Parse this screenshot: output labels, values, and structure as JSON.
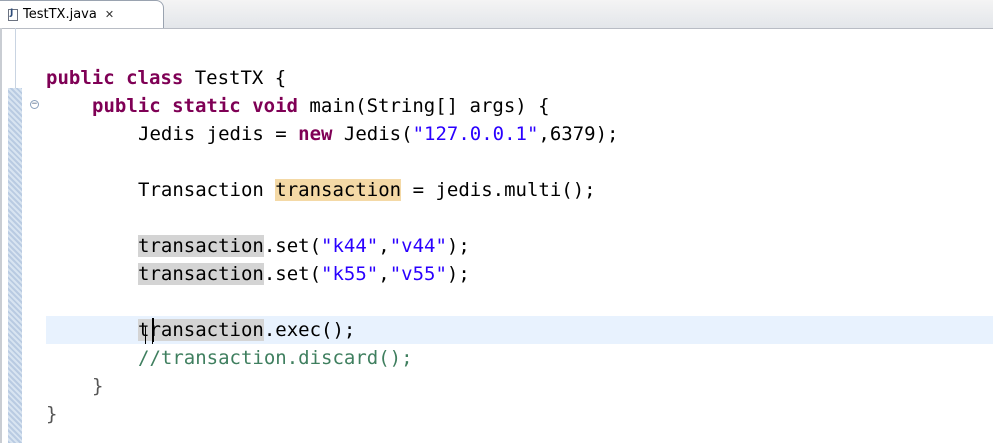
{
  "tab": {
    "title": "TestTX.java",
    "close_glyph": "✕"
  },
  "code": {
    "class_line": {
      "kw1": "public",
      "kw2": "class",
      "rest": " TestTX {"
    },
    "main_line": {
      "kw1": "public",
      "kw2": "static",
      "kw3": "void",
      "rest": " main(String[] args) {"
    },
    "jedis_line": {
      "pre": "Jedis jedis = ",
      "kw": "new",
      "mid": " Jedis(",
      "s1": "\"127.0.0.1\"",
      "post": ",6379);"
    },
    "tx_line": {
      "pre": "Transaction ",
      "var": "transaction",
      "post": " = jedis.multi();"
    },
    "set1_line": {
      "var": "transaction",
      "mid": ".set(",
      "s1": "\"k44\"",
      "comma": ",",
      "s2": "\"v44\"",
      "post": ");"
    },
    "set2_line": {
      "var": "transaction",
      "mid": ".set(",
      "s1": "\"k55\"",
      "comma": ",",
      "s2": "\"v55\"",
      "post": ");"
    },
    "exec_line": {
      "var": "transaction",
      "post": ".exec();"
    },
    "comment_line": "//transaction.discard();",
    "close_method": "}",
    "close_class": "}"
  },
  "colors": {
    "keyword": "#7f0055",
    "string": "#2a00ff",
    "comment": "#3f7f5f",
    "occurrence_highlight": "#f4d9a6",
    "current_line": "#e8f2fe"
  },
  "icons": {
    "file": "java-file-icon",
    "close": "close-icon",
    "fold": "fold-collapse-icon"
  }
}
